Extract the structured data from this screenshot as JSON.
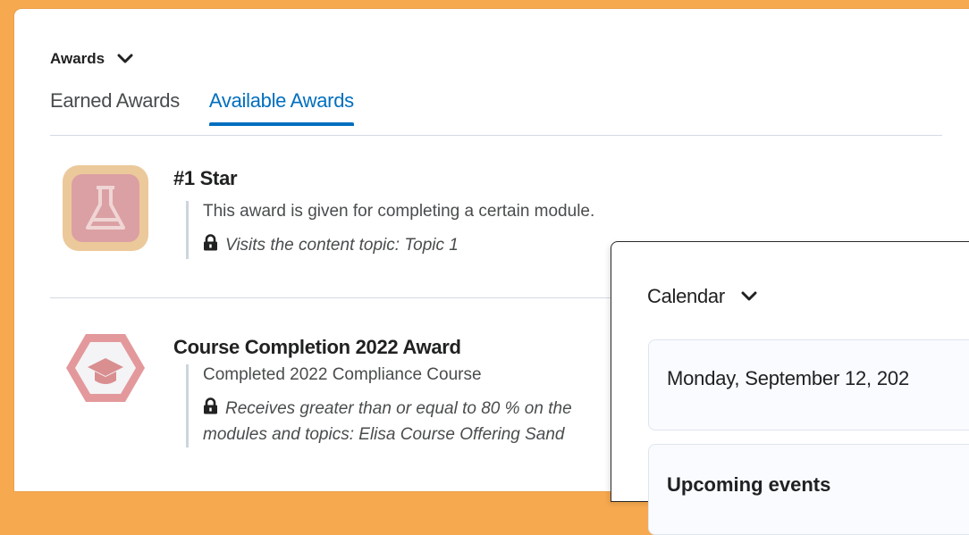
{
  "awards_widget": {
    "title": "Awards",
    "tabs": [
      {
        "label": "Earned Awards",
        "active": false
      },
      {
        "label": "Available Awards",
        "active": true
      }
    ],
    "items": [
      {
        "name": "#1 Star",
        "icon": "flask-icon",
        "description": "This award is given for completing a certain module.",
        "criteria_line1": "Visits the content topic: Topic 1"
      },
      {
        "name": "Course Completion 2022 Award",
        "icon": "graduation-cap-icon",
        "description": "Completed 2022 Compliance Course",
        "criteria_line1": "Receives greater than or equal to 80 % on the",
        "criteria_line2": "modules and topics: Elisa Course Offering Sand"
      }
    ]
  },
  "calendar_widget": {
    "title": "Calendar",
    "date": "Monday, September 12, 202",
    "events_heading": "Upcoming events"
  },
  "colors": {
    "background": "#f7a94f",
    "accent": "#006fbf",
    "badge_tan": "#ecc99b",
    "badge_pink": "#dba0a3",
    "hexagon": "#e3999b"
  }
}
